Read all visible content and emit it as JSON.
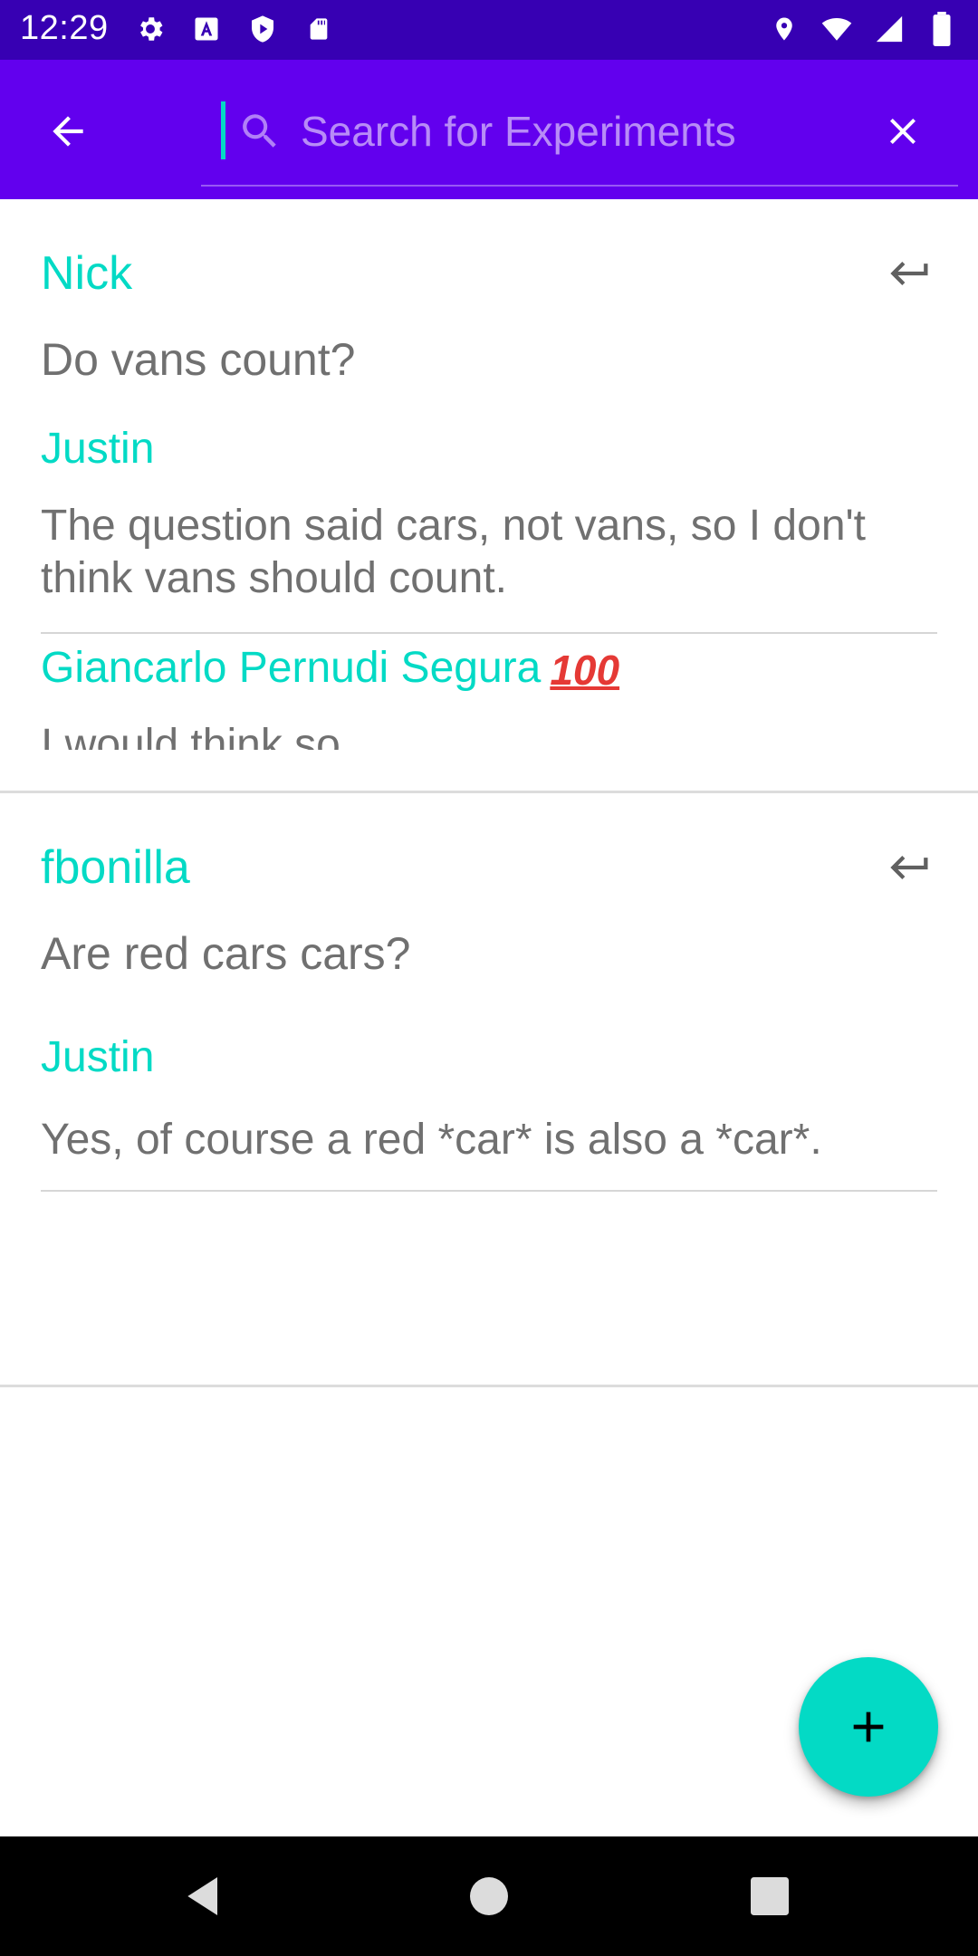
{
  "status_bar": {
    "time": "12:29",
    "left_icons": [
      "settings-icon",
      "a-box-icon",
      "shield-play-icon",
      "sd-card-icon"
    ],
    "right_icons": [
      "location-icon",
      "wifi-icon",
      "signal-icon",
      "battery-icon"
    ]
  },
  "app_bar": {
    "search_placeholder": "Search for Experiments",
    "search_value": "",
    "background": "#6200ee",
    "status_background": "#3700b3"
  },
  "threads": [
    {
      "author": "Nick",
      "question": "Do vans count?",
      "replies": [
        {
          "author": "Justin",
          "text": "The question said cars, not vans, so I don't think vans should count.",
          "badge": ""
        },
        {
          "author": "Giancarlo Pernudi Segura",
          "text": "I would think so",
          "badge": "100"
        }
      ]
    },
    {
      "author": "fbonilla",
      "question": "Are red cars cars?",
      "replies": [
        {
          "author": "Justin",
          "text": "Yes, of course a red *car* is also a *car*.",
          "badge": ""
        }
      ]
    }
  ],
  "colors": {
    "accent": "#03dac5",
    "text_secondary": "#707070"
  },
  "fab": {
    "icon": "plus-icon"
  },
  "nav_bar": {
    "icons": [
      "back-triangle-icon",
      "home-circle-icon",
      "recents-square-icon"
    ]
  }
}
